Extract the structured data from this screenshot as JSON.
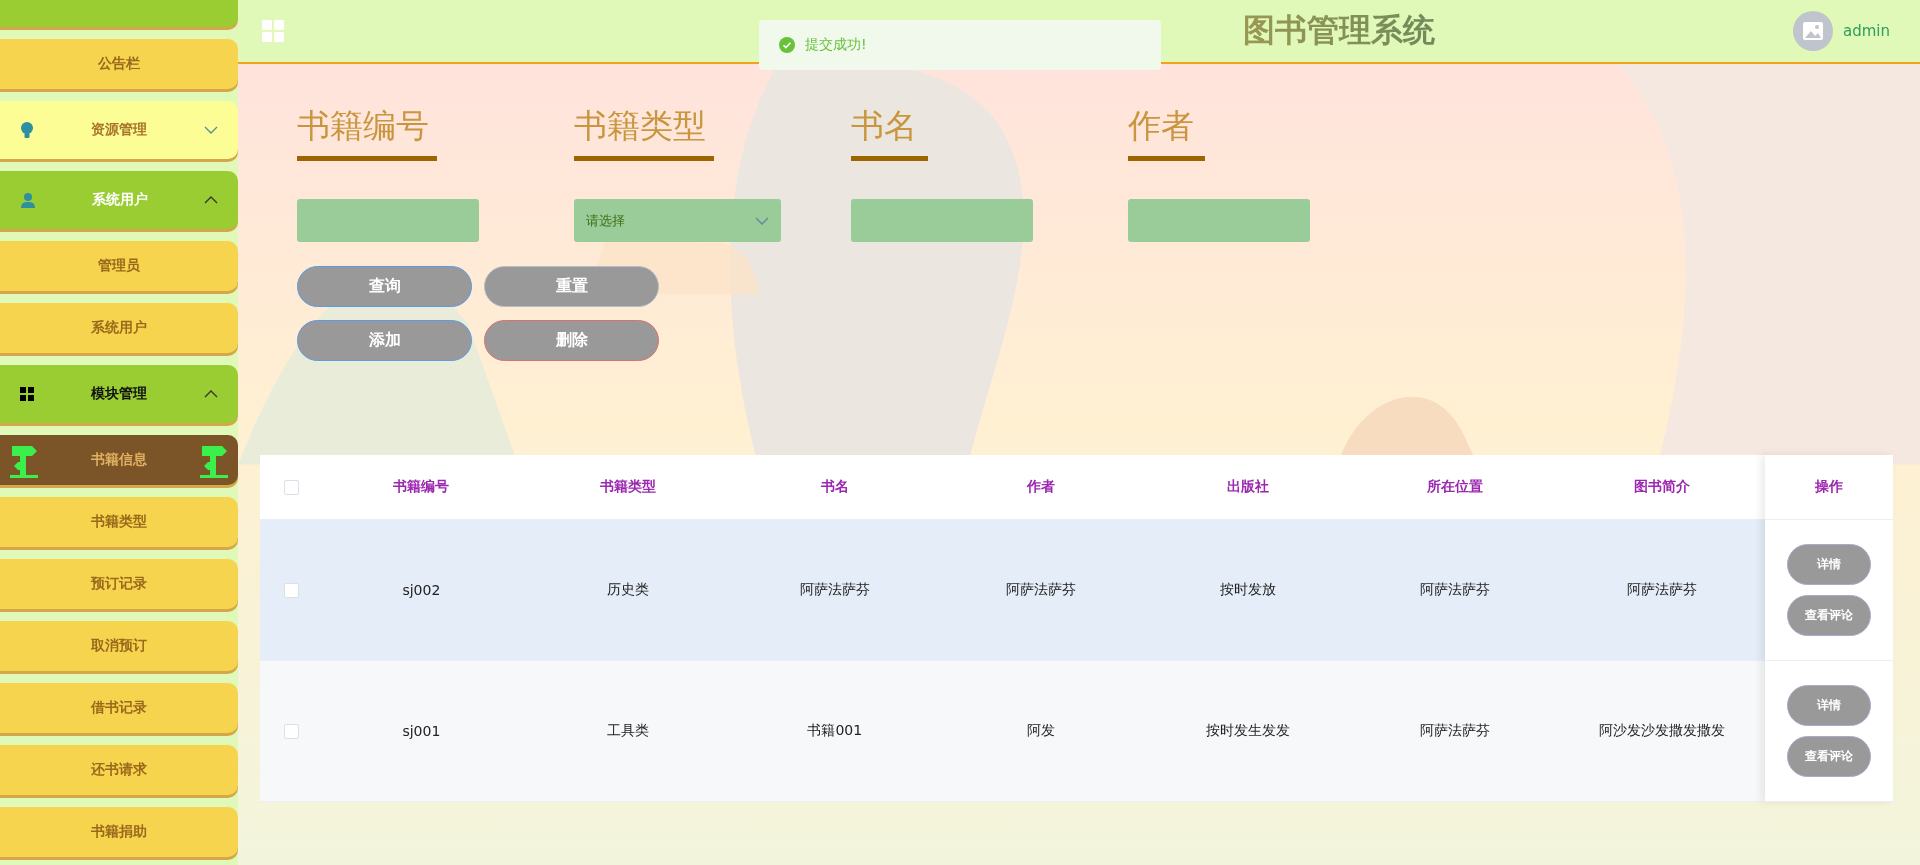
{
  "header": {
    "title": "图书管理系统",
    "user": "admin"
  },
  "toast": {
    "message": "提交成功!"
  },
  "sidebar": {
    "items": [
      {
        "kind": "group-stub",
        "expanded": true
      },
      {
        "label": "公告栏",
        "kind": "sub",
        "selected": false
      },
      {
        "label": "资源管理",
        "kind": "group",
        "expanded": false
      },
      {
        "label": "系统用户",
        "kind": "group",
        "expanded": true
      },
      {
        "label": "管理员",
        "kind": "sub",
        "selected": false
      },
      {
        "label": "系统用户",
        "kind": "sub",
        "selected": false
      },
      {
        "label": "模块管理",
        "kind": "group",
        "expanded": true
      },
      {
        "label": "书籍信息",
        "kind": "sub",
        "selected": true
      },
      {
        "label": "书籍类型",
        "kind": "sub",
        "selected": false
      },
      {
        "label": "预订记录",
        "kind": "sub",
        "selected": false
      },
      {
        "label": "取消预订",
        "kind": "sub",
        "selected": false
      },
      {
        "label": "借书记录",
        "kind": "sub",
        "selected": false
      },
      {
        "label": "还书请求",
        "kind": "sub",
        "selected": false
      },
      {
        "label": "书籍捐助",
        "kind": "sub",
        "selected": false
      }
    ]
  },
  "search": {
    "fields": [
      {
        "label": "书籍编号",
        "kind": "input"
      },
      {
        "label": "书籍类型",
        "kind": "select",
        "placeholder": "请选择"
      },
      {
        "label": "书名",
        "kind": "input"
      },
      {
        "label": "作者",
        "kind": "input"
      }
    ],
    "buttons": [
      {
        "label": "查询",
        "kind": "primary"
      },
      {
        "label": "重置",
        "kind": "plain"
      },
      {
        "label": "添加",
        "kind": "primary"
      },
      {
        "label": "删除",
        "kind": "danger"
      }
    ]
  },
  "table": {
    "all_checked": false,
    "columns": [
      "书籍编号",
      "书籍类型",
      "书名",
      "作者",
      "出版社",
      "所在位置",
      "图书简介"
    ],
    "actions_column": "操作",
    "rows": [
      {
        "checked": false,
        "highlighted": true,
        "cells": [
          "sj002",
          "历史类",
          "阿萨法萨芬",
          "阿萨法萨芬",
          "按时发放",
          "阿萨法萨芬",
          "阿萨法萨芬"
        ],
        "actions": [
          "详情",
          "查看评论"
        ]
      },
      {
        "checked": false,
        "highlighted": false,
        "cells": [
          "sj001",
          "工具类",
          "书籍001",
          "阿发",
          "按时发生发发",
          "阿萨法萨芬",
          "阿沙发沙发撒发撒发"
        ],
        "actions": [
          "详情",
          "查看评论"
        ]
      }
    ]
  }
}
